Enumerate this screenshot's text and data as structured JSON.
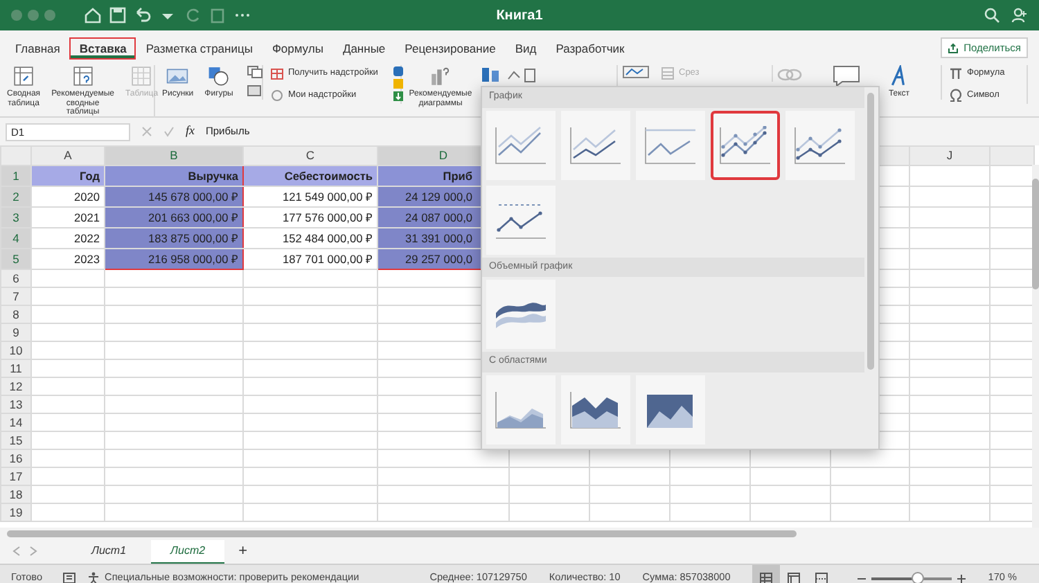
{
  "window": {
    "title": "Книга1"
  },
  "tabs": [
    {
      "label": "Главная",
      "selected": false
    },
    {
      "label": "Вставка",
      "selected": true
    },
    {
      "label": "Разметка страницы",
      "selected": false
    },
    {
      "label": "Формулы",
      "selected": false
    },
    {
      "label": "Данные",
      "selected": false
    },
    {
      "label": "Рецензирование",
      "selected": false
    },
    {
      "label": "Вид",
      "selected": false
    },
    {
      "label": "Разработчик",
      "selected": false
    }
  ],
  "share_button": "Поделиться",
  "ribbon": [
    {
      "items": [
        {
          "kind": "large",
          "label": "Сводная таблица",
          "disabled": false
        },
        {
          "kind": "large",
          "label": "Рекомендуемые сводные таблицы",
          "disabled": false
        },
        {
          "kind": "large",
          "label": "Таблица",
          "disabled": true
        }
      ]
    },
    {
      "items": [
        {
          "kind": "large",
          "label": "Рисунки",
          "disabled": false
        },
        {
          "kind": "large",
          "label": "Фигуры",
          "disabled": false
        }
      ]
    },
    {
      "items": [
        {
          "kind": "small",
          "label": "Получить надстройки",
          "disabled": false
        },
        {
          "kind": "small",
          "label": "Мои надстройки",
          "disabled": false
        }
      ]
    },
    {
      "items": [
        {
          "kind": "large",
          "label": "Рекомендуемые диаграммы",
          "disabled": false
        }
      ]
    },
    {
      "items": [
        {
          "kind": "small",
          "label": "Срез",
          "disabled": true
        }
      ]
    },
    {
      "items": [
        {
          "kind": "large",
          "label": "Текст",
          "disabled": false
        }
      ]
    },
    {
      "items": [
        {
          "kind": "small",
          "label": "Формула",
          "disabled": false
        },
        {
          "kind": "small",
          "label": "Символ",
          "disabled": false
        }
      ]
    }
  ],
  "formula_bar": {
    "name_box": "D1",
    "function_label": "fx",
    "formula": "Прибыль"
  },
  "columns": [
    {
      "label": "A",
      "selected": false
    },
    {
      "label": "B",
      "selected": true
    },
    {
      "label": "C",
      "selected": false
    },
    {
      "label": "D",
      "selected": true
    },
    {
      "label": "J",
      "selected": false
    }
  ],
  "rows": [
    {
      "label": "1",
      "selected": true,
      "kind": "header",
      "cells": [
        "Год",
        "Выручка",
        "Себестоимость",
        "Приб"
      ]
    },
    {
      "label": "2",
      "selected": true,
      "kind": "data",
      "cells": [
        "2020",
        "145 678 000,00 ₽",
        "121 549 000,00 ₽",
        "24 129 000,0"
      ]
    },
    {
      "label": "3",
      "selected": true,
      "kind": "data",
      "cells": [
        "2021",
        "201 663 000,00 ₽",
        "177 576 000,00 ₽",
        "24 087 000,0"
      ]
    },
    {
      "label": "4",
      "selected": true,
      "kind": "data",
      "cells": [
        "2022",
        "183 875 000,00 ₽",
        "152 484 000,00 ₽",
        "31 391 000,0"
      ]
    },
    {
      "label": "5",
      "selected": true,
      "kind": "data",
      "cells": [
        "2023",
        "216 958 000,00 ₽",
        "187 701 000,00 ₽",
        "29 257 000,0"
      ]
    },
    {
      "label": "6",
      "selected": false,
      "kind": "empty"
    },
    {
      "label": "7",
      "selected": false,
      "kind": "empty"
    },
    {
      "label": "8",
      "selected": false,
      "kind": "empty"
    },
    {
      "label": "9",
      "selected": false,
      "kind": "empty"
    },
    {
      "label": "10",
      "selected": false,
      "kind": "empty"
    },
    {
      "label": "11",
      "selected": false,
      "kind": "empty"
    },
    {
      "label": "12",
      "selected": false,
      "kind": "empty"
    },
    {
      "label": "13",
      "selected": false,
      "kind": "empty"
    },
    {
      "label": "14",
      "selected": false,
      "kind": "empty"
    },
    {
      "label": "15",
      "selected": false,
      "kind": "empty"
    },
    {
      "label": "16",
      "selected": false,
      "kind": "empty"
    },
    {
      "label": "17",
      "selected": false,
      "kind": "empty"
    },
    {
      "label": "18",
      "selected": false,
      "kind": "empty"
    },
    {
      "label": "19",
      "selected": false,
      "kind": "empty"
    }
  ],
  "chart_gallery": {
    "sections": [
      {
        "title": "График",
        "items": [
          {
            "kind": "line",
            "selected": false
          },
          {
            "kind": "stacked-line",
            "selected": false
          },
          {
            "kind": "line-100",
            "selected": false
          },
          {
            "kind": "line-markers",
            "selected": true
          },
          {
            "kind": "stacked-markers",
            "selected": false
          },
          {
            "kind": "markers-100",
            "selected": false
          }
        ]
      },
      {
        "title": "Объемный график",
        "items": [
          {
            "kind": "line-3d",
            "selected": false
          }
        ]
      },
      {
        "title": "С областями",
        "items": [
          {
            "kind": "area",
            "selected": false
          },
          {
            "kind": "stacked-area",
            "selected": false
          },
          {
            "kind": "area-100",
            "selected": false
          }
        ]
      }
    ]
  },
  "sheet_tabs": [
    {
      "label": "Лист1",
      "selected": false
    },
    {
      "label": "Лист2",
      "selected": true
    }
  ],
  "add_sheet": "+",
  "status_bar": {
    "ready": "Готово",
    "accessibility": "Специальные возможности: проверить рекомендации",
    "average": "Среднее: 107129750",
    "count": "Количество: 10",
    "sum": "Сумма: 857038000",
    "views": [
      {
        "kind": "normal",
        "selected": true
      },
      {
        "kind": "page-layout",
        "selected": false
      },
      {
        "kind": "page-break",
        "selected": false
      }
    ],
    "zoom": {
      "level": 0.56,
      "reading": "170 %"
    }
  }
}
